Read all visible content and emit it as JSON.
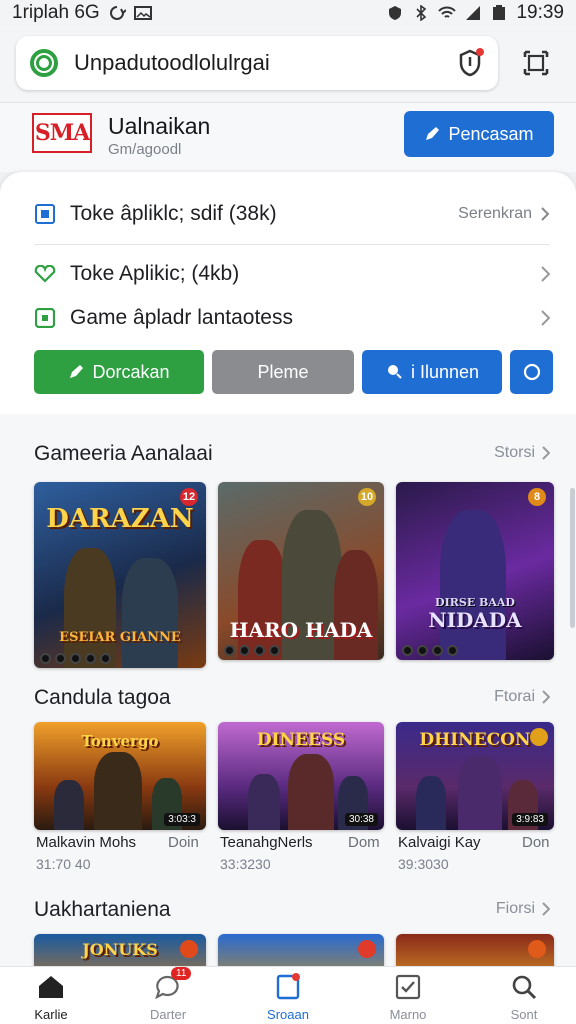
{
  "status_bar": {
    "left_text": "1riplah 6G",
    "time": "19:39"
  },
  "search": {
    "query": "Unpadutoodlolulrgai"
  },
  "app": {
    "title": "Ualnaikan",
    "subtitle": "Gm/agoodl",
    "logo_text": "SMA",
    "primary_button": "Pencasam"
  },
  "sheet": {
    "rows": [
      {
        "label": "Toke âpliklc; sdif (38k)",
        "trail": "Serenkran"
      },
      {
        "label": "Toke Aplikic; (4kb)",
        "trail": ""
      },
      {
        "label": "Game âpladr lantaotess",
        "trail": ""
      }
    ],
    "actions": {
      "download": "Dorcakan",
      "play": "Pleme",
      "share": "i Ilunnen"
    }
  },
  "sections": [
    {
      "title": "Gameeria Aanalaai",
      "more": "Storsi",
      "items": [
        {
          "art": "DARAZAN",
          "subart": "ESEIAR GIANNE",
          "badge": "12"
        },
        {
          "art": "HARO HADA",
          "subart": "",
          "badge": "10"
        },
        {
          "art": "DIRSE BAAD",
          "subart": "NIDADA",
          "badge": "8"
        }
      ]
    },
    {
      "title": "Candula tagoa",
      "more": "Ftorai",
      "items": [
        {
          "art": "Tonvergo",
          "name": "Malkavin Mohs",
          "date": "31:70 40",
          "dl": "Doin",
          "tag": "3:03:3"
        },
        {
          "art": "DINEESS",
          "name": "TeanahgNerls",
          "date": "33:3230",
          "dl": "Dom",
          "tag": "30:38"
        },
        {
          "art": "DHINECON",
          "name": "Kalvaigi Kay",
          "date": "39:3030",
          "dl": "Don",
          "tag": "3:9:83"
        }
      ]
    },
    {
      "title": "Uakhartaniena",
      "more": "Fiorsi",
      "items": [
        {
          "art": "JONUKS"
        },
        {
          "art": ""
        },
        {
          "art": ""
        }
      ]
    }
  ],
  "nav": [
    {
      "label": "Karlie",
      "active": false
    },
    {
      "label": "Darter",
      "badge": "11"
    },
    {
      "label": "Sroaan",
      "active": true
    },
    {
      "label": "Marno"
    },
    {
      "label": "Sont"
    }
  ],
  "colors": {
    "primary": "#1f6ed4",
    "green": "#2ea041",
    "grey": "#8a8c90",
    "accent_red": "#e53935"
  }
}
